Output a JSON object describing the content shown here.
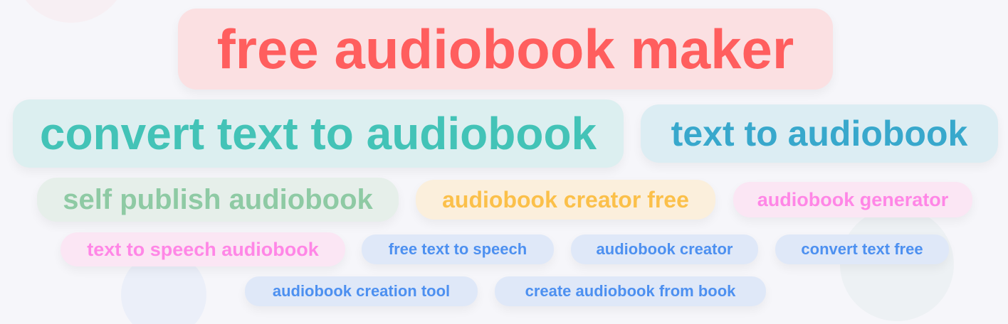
{
  "tags": [
    {
      "label": "free audiobook maker",
      "color": "#ff5e5e"
    },
    {
      "label": "convert text to audiobook",
      "color": "#43c3b7"
    },
    {
      "label": "text to audiobook",
      "color": "#38a8cc"
    },
    {
      "label": "self publish audiobook",
      "color": "#8ecaa4"
    },
    {
      "label": "audiobook creator free",
      "color": "#fbc04a"
    },
    {
      "label": "audiobook generator",
      "color": "#ff86e6"
    },
    {
      "label": "text to speech audiobook",
      "color": "#ff86e6"
    },
    {
      "label": "free text to speech",
      "color": "#4d90f0"
    },
    {
      "label": "audiobook creator",
      "color": "#4d90f0"
    },
    {
      "label": "convert text free",
      "color": "#4d90f0"
    },
    {
      "label": "audiobook creation tool",
      "color": "#4d90f0"
    },
    {
      "label": "create audiobook from book",
      "color": "#4d90f0"
    }
  ]
}
